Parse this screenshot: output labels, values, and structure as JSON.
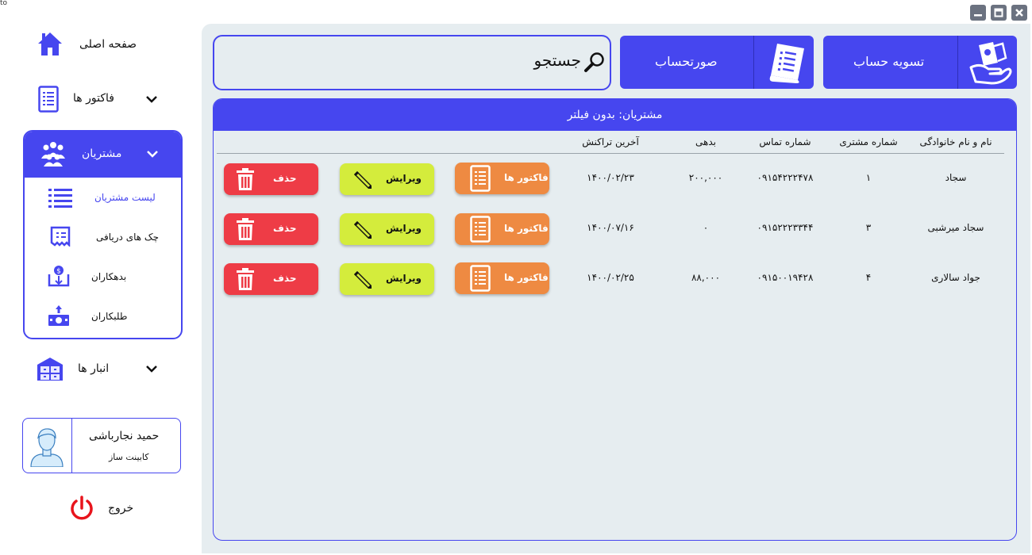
{
  "window": {
    "corner_text": "to"
  },
  "sidebar": {
    "home_label": "صفحه اصلی",
    "invoices_label": "فاکتور ها",
    "customers_label": "مشتریان",
    "customers_sub": [
      {
        "label": "لیست مشتریان",
        "icon": "list-icon",
        "active": true
      },
      {
        "label": "چک های دریافی",
        "icon": "check-receipt-icon",
        "active": false
      },
      {
        "label": "بدهکاران",
        "icon": "debtors-icon",
        "active": false
      },
      {
        "label": "طلبکاران",
        "icon": "creditors-icon",
        "active": false
      }
    ],
    "warehouses_label": "انبار ها",
    "profile": {
      "name": "حمید نجارباشی",
      "role": "کابینت ساز"
    },
    "logout_label": "خروج"
  },
  "top": {
    "search_placeholder": "جستجو",
    "invoice_btn": "صورتحساب",
    "settle_btn": "تسویه حساب"
  },
  "table": {
    "title": "مشتریان: بدون فیلتر",
    "headers": {
      "name": "نام و نام خانوادگی",
      "id": "شماره مشتری",
      "phone": "شماره تماس",
      "debt": "بدهی",
      "last": "آخرین تراکنش"
    },
    "rows": [
      {
        "name": "سجاد",
        "id": "۱",
        "phone": "۰۹۱۵۴۲۲۲۴۷۸",
        "debt": "۲۰۰,۰۰۰",
        "last": "۱۴۰۰/۰۲/۲۳"
      },
      {
        "name": "سجاد میرشبی",
        "id": "۳",
        "phone": "۰۹۱۵۲۲۲۳۳۴۴",
        "debt": "۰",
        "last": "۱۴۰۰/۰۷/۱۶"
      },
      {
        "name": "جواد سالاری",
        "id": "۴",
        "phone": "۰۹۱۵۰۰۱۹۴۲۸",
        "debt": "۸۸,۰۰۰",
        "last": "۱۴۰۰/۰۲/۲۵"
      }
    ],
    "row_buttons": {
      "invoices": "فاکتور ها",
      "edit": "ویرایش",
      "delete": "حذف"
    }
  },
  "colors": {
    "accent": "#4646ef",
    "orange": "#ee8a42",
    "lime": "#d4ec3c",
    "red": "#ee3c46",
    "bg": "#e6edf0"
  }
}
